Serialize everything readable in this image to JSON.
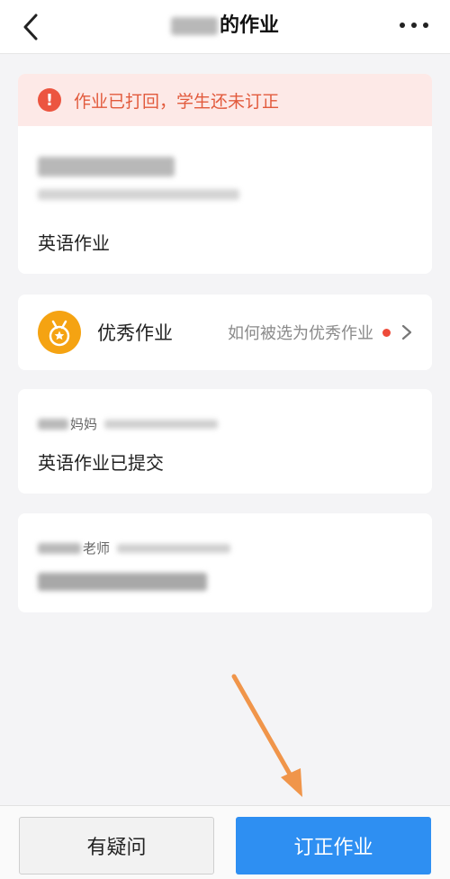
{
  "nav": {
    "title_suffix": "的作业",
    "back_icon": "chevron-left-icon",
    "more_icon": "more-horizontal-icon"
  },
  "status_card": {
    "alert_text": "作业已打回，学生还未订正",
    "alert_icon": "exclamation-icon",
    "homework_type": "英语作业"
  },
  "excellent_card": {
    "label": "优秀作业",
    "link_text": "如何被选为优秀作业",
    "icon": "medal-star-icon"
  },
  "submission": {
    "sender_suffix": "妈妈",
    "body": "英语作业已提交"
  },
  "review": {
    "sender_suffix": "老师"
  },
  "actions": {
    "question_label": "有疑问",
    "correct_label": "订正作业"
  },
  "colors": {
    "alert_bg": "#fde9e7",
    "alert_text": "#e25a3c",
    "medal": "#f5a312",
    "primary": "#2e8ff2",
    "arrow": "#f0954a",
    "red_dot": "#ee4b3a"
  }
}
